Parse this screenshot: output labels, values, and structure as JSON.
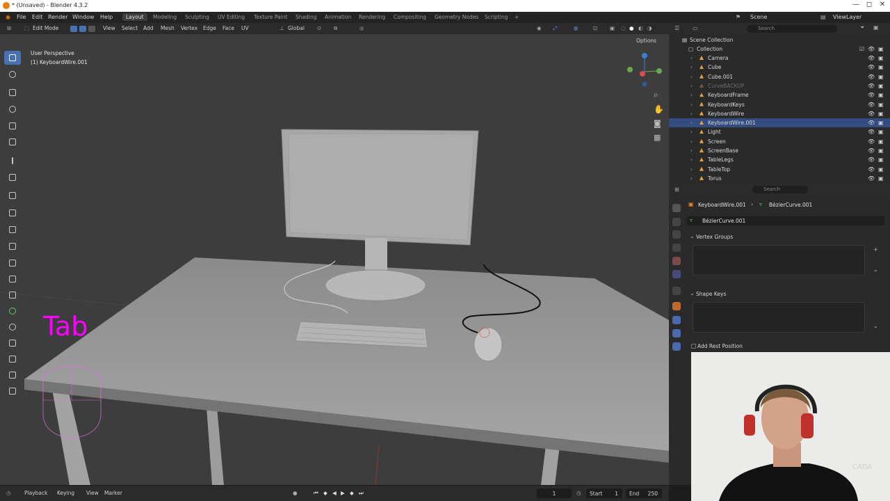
{
  "window": {
    "title": "* (Unsaved) - Blender 4.3.2",
    "controls": [
      "—",
      "◻",
      "✕"
    ]
  },
  "menu": [
    "File",
    "Edit",
    "Render",
    "Window",
    "Help"
  ],
  "workspaces": [
    "Layout",
    "Modeling",
    "Sculpting",
    "UV Editing",
    "Texture Paint",
    "Shading",
    "Animation",
    "Rendering",
    "Compositing",
    "Geometry Nodes",
    "Scripting",
    "+"
  ],
  "active_workspace": "Layout",
  "scene": {
    "label": "Scene",
    "view_layer": "ViewLayer"
  },
  "viewport_header": {
    "mode": "Edit Mode",
    "menus": [
      "View",
      "Select",
      "Add",
      "Mesh",
      "Vertex",
      "Edge",
      "Face",
      "UV"
    ],
    "orientation": "Global",
    "options": "Options"
  },
  "viewport": {
    "perspective": "User Perspective",
    "object": "(1) KeyboardWire.001",
    "keystroke": "Tab",
    "axes": [
      "Y",
      "X",
      "Z"
    ]
  },
  "outliner": {
    "search_placeholder": "Search",
    "root": "Scene Collection",
    "collection": "Collection",
    "items": [
      "Camera",
      "Cube",
      "Cube.001",
      "CurveBACKUP",
      "KeyboardFrame",
      "KeyboardKeys",
      "KeyboardWire",
      "KeyboardWire.001",
      "Light",
      "Screen",
      "ScreenBase",
      "TableLegs",
      "TableTop",
      "Torus"
    ],
    "selected": "KeyboardWire.001",
    "dimmed": "CurveBACKUP"
  },
  "properties": {
    "search_placeholder": "Search",
    "breadcrumb_object": "KeyboardWire.001",
    "breadcrumb_data": "BézierCurve.001",
    "data_name": "BézierCurve.001",
    "panels": [
      "Vertex Groups",
      "Shape Keys"
    ],
    "add_rest_position": "Add Rest Position"
  },
  "timeline": {
    "menus": [
      "Playback",
      "Keying",
      "View",
      "Marker"
    ],
    "current_frame": "1",
    "start_label": "Start",
    "start": "1",
    "end_label": "End",
    "end": "250"
  },
  "webcam": {
    "watermark": "CADA"
  },
  "colors": {
    "accent": "#4772b3",
    "selected_row": "#334d80",
    "keystroke": "#ff00ff",
    "bg": "#3d3d3d"
  }
}
